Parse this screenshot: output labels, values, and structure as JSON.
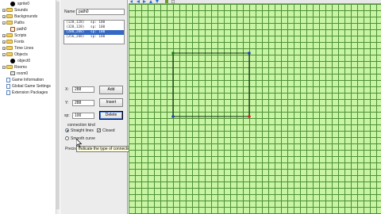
{
  "tree": {
    "items": [
      {
        "label": "sprite0",
        "icon": "sprite",
        "indent": 2
      },
      {
        "label": "Sounds",
        "icon": "folder",
        "indent": 0
      },
      {
        "label": "Backgrounds",
        "icon": "folder",
        "indent": 0
      },
      {
        "label": "Paths",
        "icon": "folder",
        "indent": 0
      },
      {
        "label": "path0",
        "icon": "path",
        "indent": 2
      },
      {
        "label": "Scripts",
        "icon": "folder",
        "indent": 0
      },
      {
        "label": "Fonts",
        "icon": "folder",
        "indent": 0
      },
      {
        "label": "Time Lines",
        "icon": "folder",
        "indent": 0
      },
      {
        "label": "Objects",
        "icon": "folder",
        "indent": 0
      },
      {
        "label": "object0",
        "icon": "sprite",
        "indent": 2
      },
      {
        "label": "Rooms",
        "icon": "folder",
        "indent": 0
      },
      {
        "label": "room0",
        "icon": "room",
        "indent": 2
      },
      {
        "label": "Game Information",
        "icon": "doc",
        "indent": 1
      },
      {
        "label": "Global Game Settings",
        "icon": "doc",
        "indent": 1
      },
      {
        "label": "Extension Packages",
        "icon": "doc",
        "indent": 1
      }
    ]
  },
  "panel": {
    "name_label": "Name:",
    "name_value": "path0",
    "points": [
      {
        "text": "(128,128)   sp: 100",
        "selected": false
      },
      {
        "text": "(320,128)   sp: 100",
        "selected": false
      },
      {
        "text": "(288,288)   sp: 100",
        "selected": true
      },
      {
        "text": "(256,288)   sp: 100",
        "selected": false
      }
    ],
    "x_label": "X:",
    "x_value": "288",
    "y_label": "Y:",
    "y_value": "288",
    "sp_label": "sp:",
    "sp_value": "100",
    "add_label": "Add",
    "insert_label": "Insert",
    "delete_label": "Delete",
    "connection_label": "connection kind",
    "straight_label": "Straight lines",
    "smooth_label": "Smooth curve",
    "closed_label": "Closed",
    "closed_checked": true,
    "precision_label": "Precis",
    "tooltip": "Indicate the type of connections between the points"
  },
  "canvas": {
    "path_points": [
      [
        128,
        128
      ],
      [
        320,
        128
      ],
      [
        320,
        288
      ],
      [
        128,
        288
      ]
    ],
    "point_colors": [
      "#1b7a1b",
      "#1f3fbf",
      "#d22222",
      "#1f3fbf"
    ],
    "grid_color": "#4f8f37",
    "bg_color": "#c7f5a3"
  }
}
